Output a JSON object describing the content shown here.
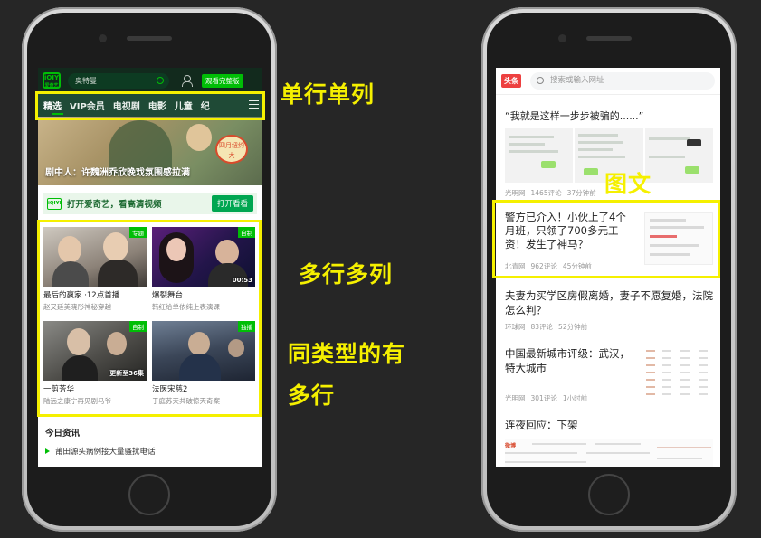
{
  "left_app": {
    "logo_text": "爱奇艺",
    "search_text": "奥特曼",
    "vip_button": "观看完整版",
    "tabs": [
      "精选",
      "VIP会员",
      "电视剧",
      "电影",
      "儿童",
      "纪"
    ],
    "banner_caption": "剧中人：许魏洲乔欣晚戏氛围感拉满",
    "banner_badge": "四月纽约大",
    "promo_text": "打开爱奇艺，看高清视频",
    "promo_button": "打开看看",
    "cards": [
      {
        "tag": "专题",
        "overlay": "",
        "title": "最后的赢家 ·12点首播",
        "sub": "赵又廷美晓彤神秘穿越"
      },
      {
        "tag": "自制",
        "overlay": "00:53",
        "title": "爆裂舞台",
        "sub": "韩红给单依纯上表演课"
      },
      {
        "tag": "自制",
        "overlay": "更新至36集",
        "title": "一剪芳华",
        "sub": "陆远之康宁再见剧马爷"
      },
      {
        "tag": "独播",
        "overlay": "",
        "title": "法医宋慈2",
        "sub": "于庭苏天共破惊天奇案"
      }
    ],
    "news_heading": "今日资讯",
    "news_item": "莆田源头病例接大量骚扰电话"
  },
  "right_app": {
    "logo_text": "头条",
    "search_placeholder": "搜索或输入网址",
    "articles": [
      {
        "title": "“我就是这样一步步被骗的......”",
        "source": "光明网",
        "comments": "1465评论",
        "time": "37分钟前"
      },
      {
        "title": "警方已介入！小伙上了4个月班，只领了700多元工资！发生了神马？",
        "source": "北青网",
        "comments": "962评论",
        "time": "45分钟前"
      },
      {
        "title": "夫妻为买学区房假离婚，妻子不愿复婚，法院怎么判？",
        "source": "环球网",
        "comments": "83评论",
        "time": "52分钟前"
      },
      {
        "title": "中国最新城市评级：武汉，特大城市",
        "source": "光明网",
        "comments": "301评论",
        "time": "1小时前"
      },
      {
        "title": "连夜回应：下架",
        "source": "",
        "comments": "",
        "time": ""
      }
    ],
    "strip_label": "微博"
  },
  "annotations": {
    "single_row": "单行单列",
    "multi_row": "多行多列",
    "same_type_1": "同类型的有",
    "same_type_2": "多行",
    "image_text": "图文"
  },
  "colors": {
    "highlight": "#f5f000",
    "iqiyi_green": "#00be06",
    "toutiao_red": "#ed4040"
  }
}
